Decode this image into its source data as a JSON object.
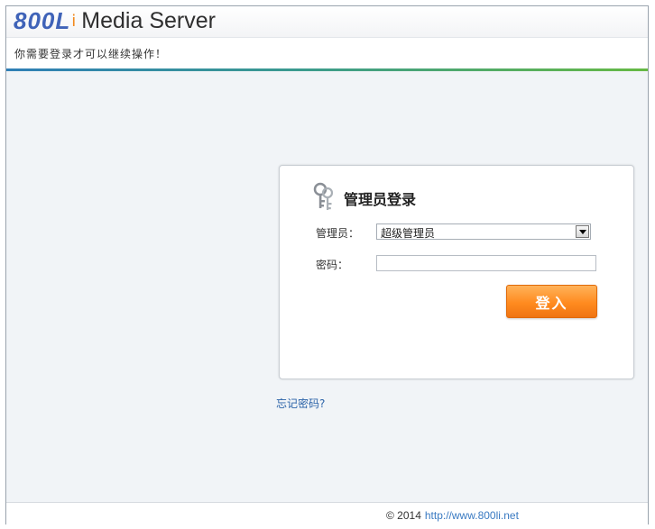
{
  "header": {
    "logo_brand": "800L",
    "logo_accent": "i",
    "logo_title": "Media Server"
  },
  "notice": {
    "text": "你需要登录才可以继续操作！"
  },
  "login": {
    "title": "管理员登录",
    "admin_label": "管理员：",
    "admin_selected": "超级管理员",
    "password_label": "密码：",
    "password_value": "",
    "submit_label": "登入",
    "forgot_link": "忘记密码?"
  },
  "footer": {
    "copyright": "© 2014",
    "link": "http://www.800li.net"
  },
  "icons": {
    "login_icon": "key-icon",
    "select_arrow": "chevron-down-icon"
  },
  "colors": {
    "brand_blue": "#3f63b8",
    "brand_orange": "#f28a1e",
    "button_orange": "#ff8b1f",
    "link_blue": "#2a62a8"
  }
}
